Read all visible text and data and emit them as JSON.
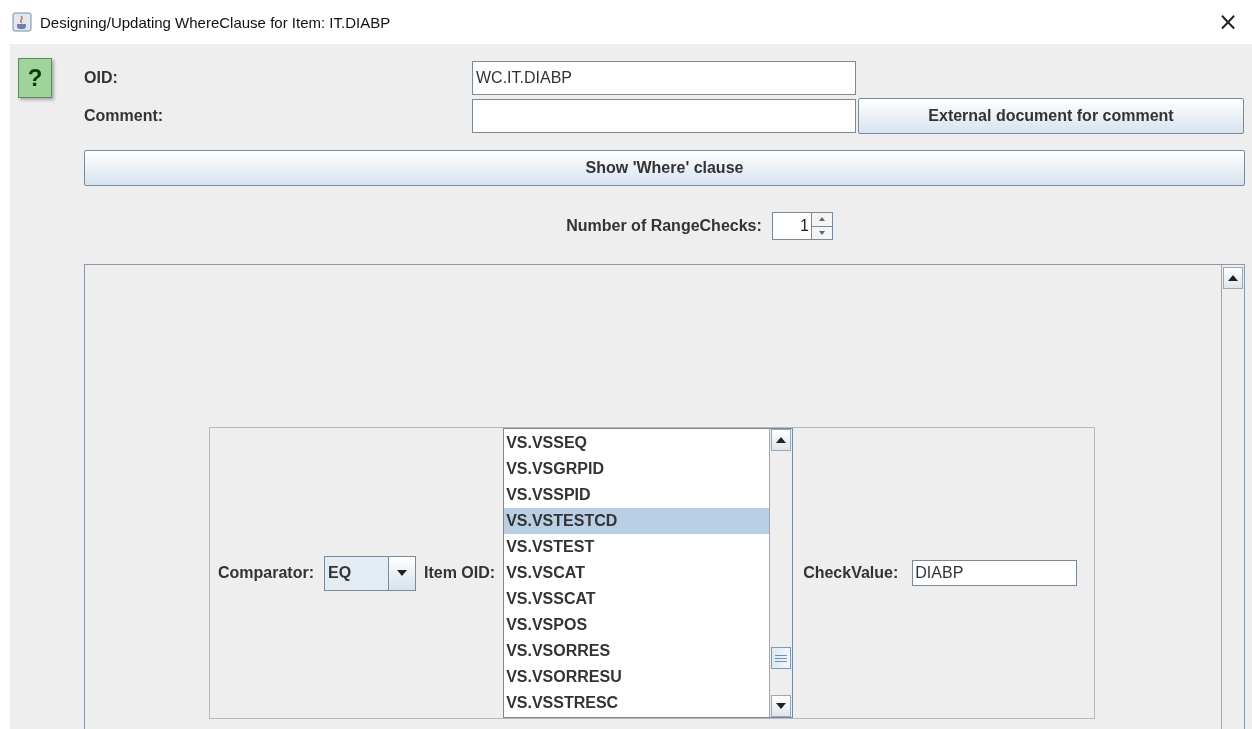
{
  "window": {
    "title": "Designing/Updating WhereClause for Item: IT.DIABP",
    "close_glyph": "×"
  },
  "help": {
    "glyph": "?"
  },
  "oid": {
    "label": "OID:",
    "value": "WC.IT.DIABP"
  },
  "comment": {
    "label": "Comment:",
    "button": "External document for comment"
  },
  "show_where_button": "Show 'Where' clause",
  "range_checks": {
    "label": "Number of RangeChecks:",
    "value": "1"
  },
  "range_check": {
    "comparator": {
      "label": "Comparator:",
      "value": "EQ"
    },
    "item_oid": {
      "label": "Item OID:",
      "items": [
        {
          "label": "VS.VSSEQ",
          "selected": false
        },
        {
          "label": "VS.VSGRPID",
          "selected": false
        },
        {
          "label": "VS.VSSPID",
          "selected": false
        },
        {
          "label": "VS.VSTESTCD",
          "selected": true
        },
        {
          "label": "VS.VSTEST",
          "selected": false
        },
        {
          "label": "VS.VSCAT",
          "selected": false
        },
        {
          "label": "VS.VSSCAT",
          "selected": false
        },
        {
          "label": "VS.VSPOS",
          "selected": false
        },
        {
          "label": "VS.VSORRES",
          "selected": false
        },
        {
          "label": "VS.VSORRESU",
          "selected": false
        },
        {
          "label": "VS.VSSTRESC",
          "selected": false
        }
      ]
    },
    "check_value": {
      "label": "CheckValue:",
      "value": "DIABP"
    }
  }
}
